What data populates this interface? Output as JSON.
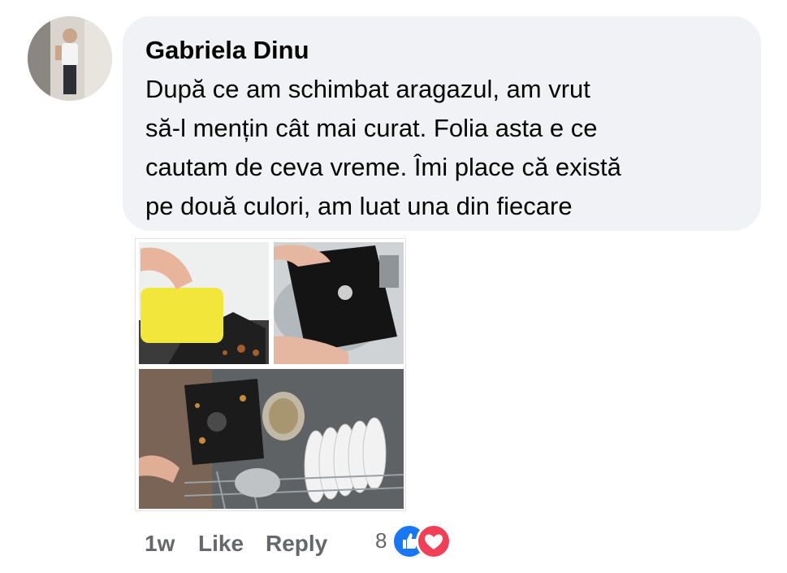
{
  "comment": {
    "author": "Gabriela Dinu",
    "text_lines": [
      "După ce am schimbat aragazul, am vrut",
      "să-l mențin cât mai curat. Folia asta e ce",
      "cautam de ceva vreme. Îmi place că există",
      "pe două culori, am luat una din fiecare"
    ],
    "photo": {
      "panel_names": [
        "sponge-cleaning",
        "sink-washing",
        "dishwasher"
      ]
    }
  },
  "actions": {
    "time": "1w",
    "like": "Like",
    "reply": "Reply"
  },
  "reactions": {
    "count": "8",
    "icons": [
      "like-icon",
      "love-icon"
    ],
    "colors": {
      "like": "#1877f2",
      "love": "#f33e58"
    }
  },
  "colors": {
    "bubble": "#f0f2f5",
    "text": "#050505",
    "muted": "#65676b"
  }
}
